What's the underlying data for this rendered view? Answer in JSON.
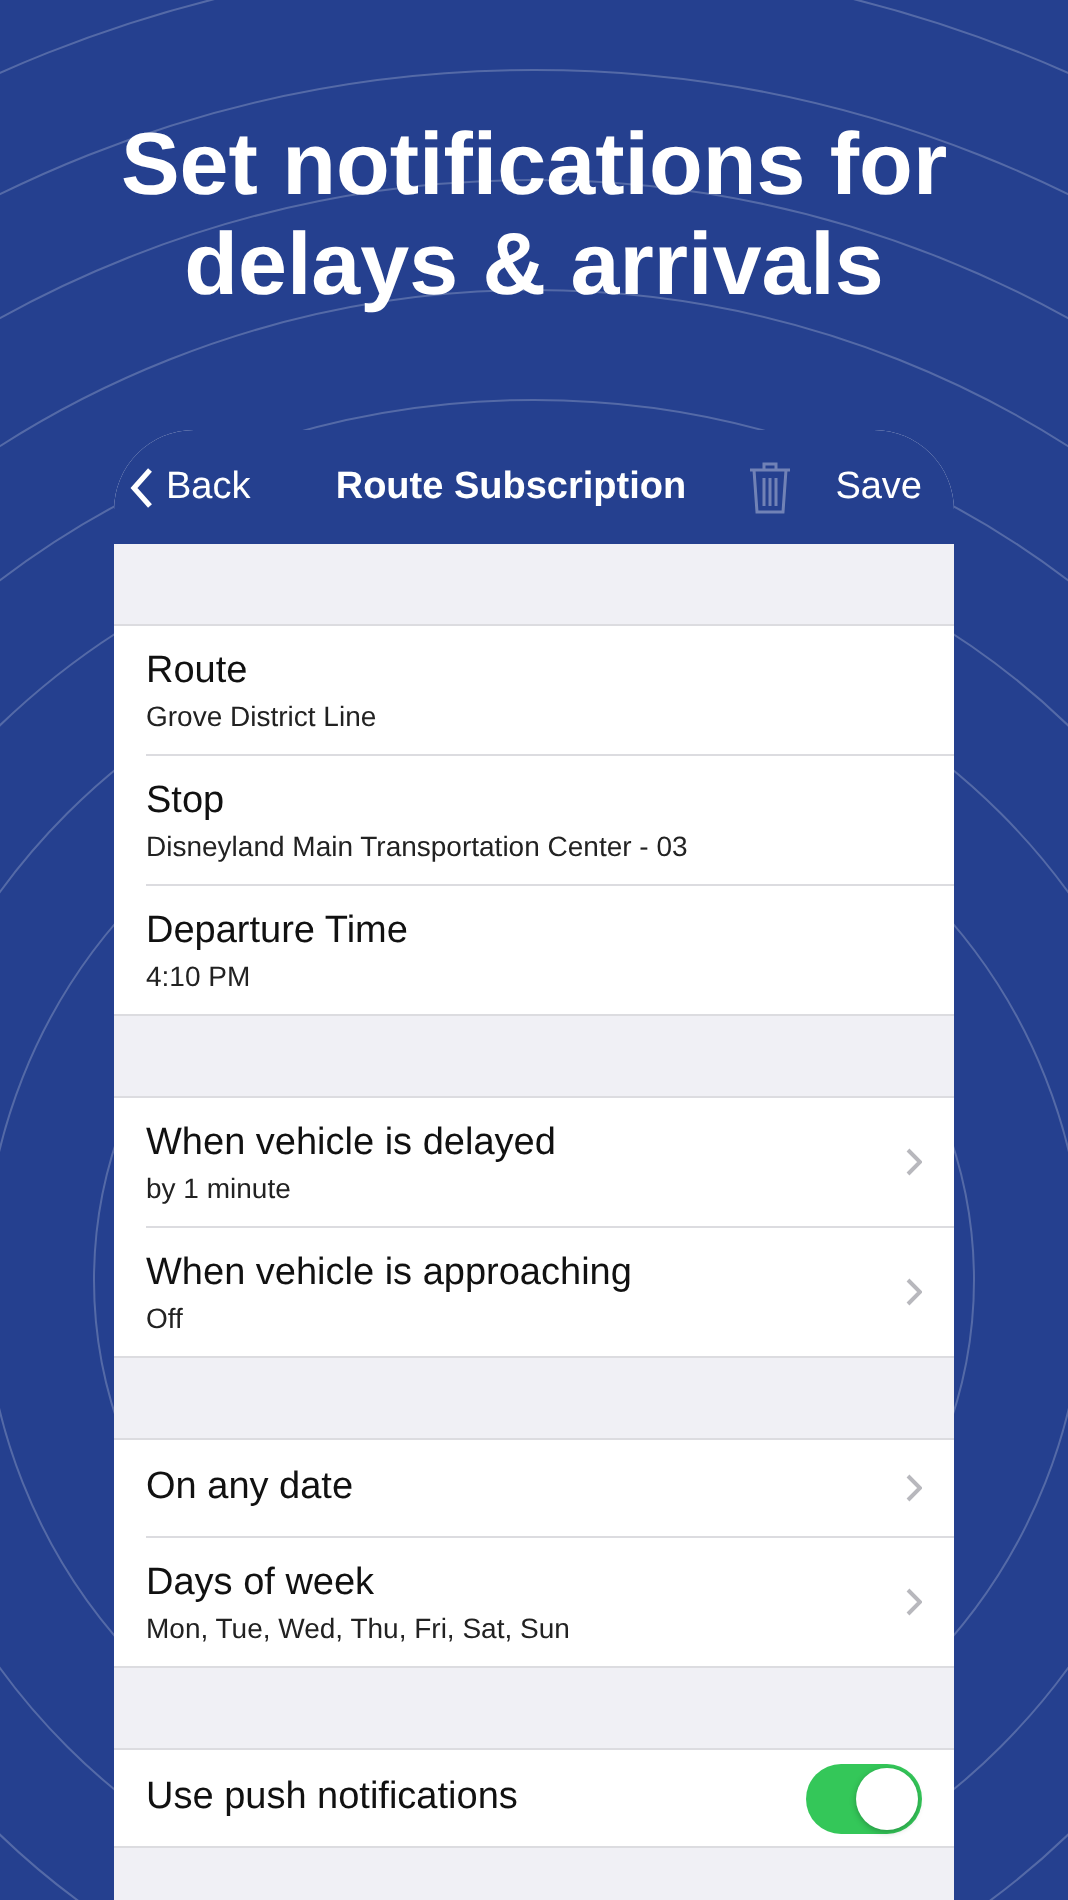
{
  "headline": "Set notifications for delays & arrivals",
  "nav": {
    "back": "Back",
    "title": "Route Subscription",
    "delete_disabled": true,
    "save": "Save"
  },
  "sections": [
    {
      "rows": [
        {
          "kind": "detail",
          "title": "Route",
          "subtitle": "Grove District Line"
        },
        {
          "kind": "detail",
          "title": "Stop",
          "subtitle": "Disneyland Main Transportation Center - 03"
        },
        {
          "kind": "detail",
          "title": "Departure Time",
          "subtitle": "4:10 PM"
        }
      ]
    },
    {
      "rows": [
        {
          "kind": "link",
          "title": "When vehicle is delayed",
          "subtitle": "by 1 minute"
        },
        {
          "kind": "link",
          "title": "When vehicle is approaching",
          "subtitle": "Off"
        }
      ]
    },
    {
      "rows": [
        {
          "kind": "link",
          "title": "On any date"
        },
        {
          "kind": "link",
          "title": "Days of week",
          "subtitle": "Mon, Tue, Wed, Thu, Fri, Sat, Sun"
        }
      ]
    },
    {
      "rows": [
        {
          "kind": "toggle",
          "title": "Use push notifications",
          "on": true
        }
      ]
    }
  ]
}
